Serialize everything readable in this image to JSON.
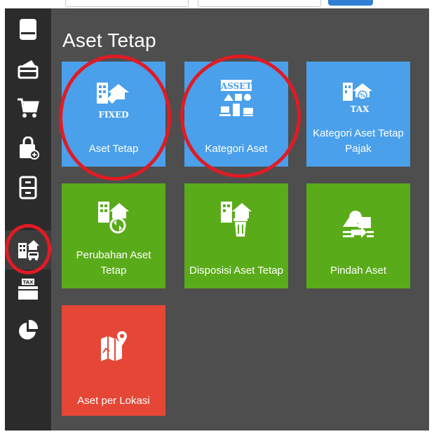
{
  "page_title": "Aset Tetap",
  "tiles": [
    {
      "label": "Aset Tetap",
      "icon": "fixed-asset-icon",
      "icon_text": "FIXED",
      "color": "#4aa0ea"
    },
    {
      "label": "Kategori Aset",
      "icon": "asset-category-icon",
      "icon_text": "ASSET",
      "color": "#4aa0ea"
    },
    {
      "label": "Kategori Aset Tetap Pajak",
      "icon": "tax-asset-category-icon",
      "icon_text": "TAX",
      "color": "#4aa0ea"
    },
    {
      "label": "Perubahan Aset Tetap",
      "icon": "asset-change-icon",
      "color": "#5aab1a"
    },
    {
      "label": "Disposisi Aset Tetap",
      "icon": "asset-disposal-icon",
      "color": "#5aab1a"
    },
    {
      "label": "Pindah Aset",
      "icon": "asset-transfer-icon",
      "color": "#5aab1a"
    },
    {
      "label": "Aset per Lokasi",
      "icon": "asset-location-map-icon",
      "color": "#e54636"
    }
  ],
  "sidebar": {
    "items": [
      {
        "icon": "book-icon"
      },
      {
        "icon": "wallet-icon"
      },
      {
        "icon": "shopping-cart-icon"
      },
      {
        "icon": "shopping-bag-icon"
      },
      {
        "icon": "filing-cabinet-icon"
      },
      {
        "icon": "fixed-asset-icon",
        "active": true
      },
      {
        "icon": "tax-icon",
        "icon_text": "TAX"
      },
      {
        "icon": "pie-chart-icon"
      }
    ]
  },
  "colors": {
    "sidebar": "#2b2b2b",
    "main": "#4e4e4e",
    "blue": "#4aa0ea",
    "green": "#5aab1a",
    "red": "#e54636",
    "highlight": "#e01b24"
  }
}
